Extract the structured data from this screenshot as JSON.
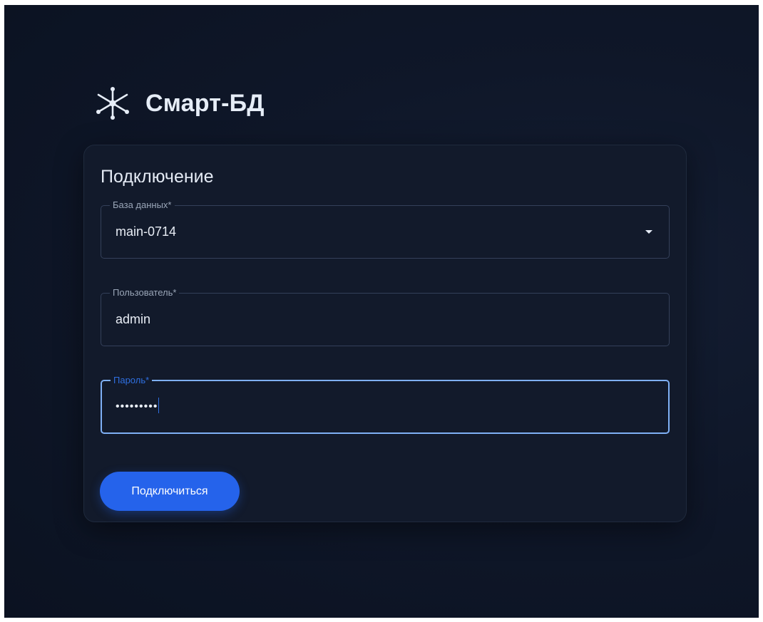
{
  "app": {
    "title": "Смарт-БД",
    "logo_icon": "network-hub-icon"
  },
  "form": {
    "title": "Подключение",
    "database": {
      "label": "База данных*",
      "value": "main-0714"
    },
    "user": {
      "label": "Пользователь*",
      "value": "admin"
    },
    "password": {
      "label": "Пароль*",
      "value": "•••••••••"
    },
    "submit_label": "Подключиться"
  },
  "colors": {
    "background": "#0f1729",
    "card": "#121a2b",
    "accent": "#2563eb",
    "focus_border": "#7fb0f5",
    "text": "#e8edf5"
  }
}
